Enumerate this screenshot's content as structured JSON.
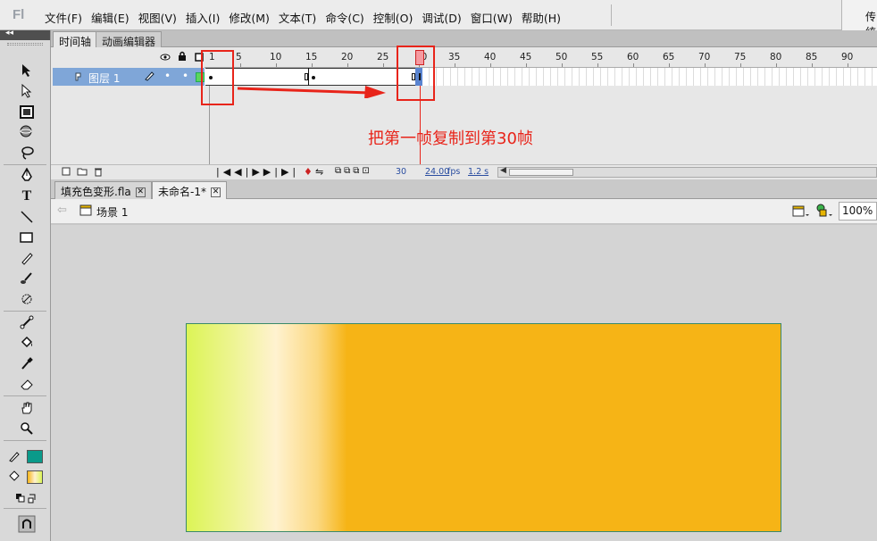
{
  "menubar": {
    "logo": "Fl",
    "items": [
      "文件(F)",
      "编辑(E)",
      "视图(V)",
      "插入(I)",
      "修改(M)",
      "文本(T)",
      "命令(C)",
      "控制(O)",
      "调试(D)",
      "窗口(W)",
      "帮助(H)"
    ],
    "workspace": "传统"
  },
  "timeline": {
    "tabs": [
      "时间轴",
      "动画编辑器"
    ],
    "ruler": [
      "1",
      "5",
      "10",
      "15",
      "20",
      "25",
      "30",
      "35",
      "40",
      "45",
      "50",
      "55",
      "60",
      "65",
      "70",
      "75",
      "80",
      "85",
      "90"
    ],
    "layer": "图层 1",
    "status": {
      "frame": "30",
      "fps": "24.00",
      "fps_unit": "fps",
      "time": "1.2 s"
    }
  },
  "doc_tabs": [
    "填充色变形.fla",
    "未命名-1*"
  ],
  "scene": {
    "label": "场景 1",
    "zoom": "100%"
  },
  "annotation": "把第一帧复制到第30帧",
  "colors": {
    "stroke": "#0a9a8a",
    "fill_start": "#dcf456",
    "fill_mid": "#fff2d0",
    "fill_end": "#f6b416",
    "annotation": "#e8241a"
  }
}
